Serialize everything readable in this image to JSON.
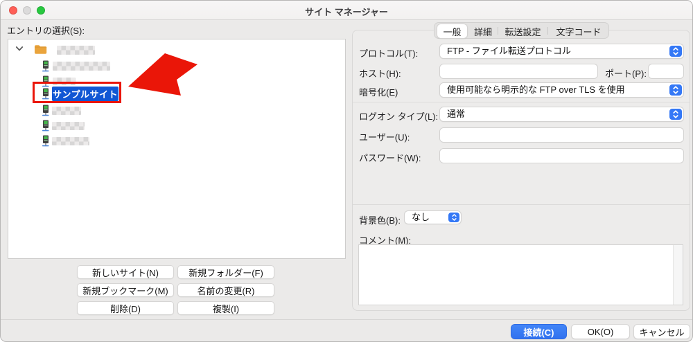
{
  "window": {
    "title": "サイト マネージャー"
  },
  "colors": {
    "accent_blue": "#3478f6",
    "selection_blue": "#1157d4",
    "annotation_red": "#ea150a",
    "folder_yellow": "#eaa43c",
    "server_green": "#43b54a"
  },
  "icons": {
    "expander": "chevron-down-icon",
    "folder": "folder-icon",
    "site": "server-icon",
    "select_control": "up-down-chevron-icon",
    "annotation": "red-arrow-icon"
  },
  "sidebar": {
    "label": "エントリの選択(S):",
    "selected_entry": "サンプルサイト",
    "buttons": [
      "新しいサイト(N)",
      "新規フォルダー(F)",
      "新規ブックマーク(M)",
      "名前の変更(R)",
      "削除(D)",
      "複製(I)"
    ]
  },
  "tabs": {
    "items": [
      "一般",
      "詳細",
      "転送設定",
      "文字コード"
    ],
    "selected": "一般"
  },
  "form": {
    "protocol": {
      "label": "プロトコル(T):",
      "value": "FTP - ファイル転送プロトコル"
    },
    "host": {
      "label": "ホスト(H):",
      "value": ""
    },
    "port": {
      "label": "ポート(P):",
      "value": ""
    },
    "encryption": {
      "label": "暗号化(E)",
      "value": "使用可能なら明示的な FTP over TLS を使用"
    },
    "logon_type": {
      "label": "ログオン タイプ(L):",
      "value": "通常"
    },
    "user": {
      "label": "ユーザー(U):",
      "value": ""
    },
    "password": {
      "label": "パスワード(W):",
      "value": ""
    },
    "background_color": {
      "label": "背景色(B):",
      "value": "なし"
    },
    "comment": {
      "label": "コメント(M):",
      "value": ""
    }
  },
  "footer": {
    "connect": "接続(C)",
    "ok": "OK(O)",
    "cancel": "キャンセル"
  }
}
